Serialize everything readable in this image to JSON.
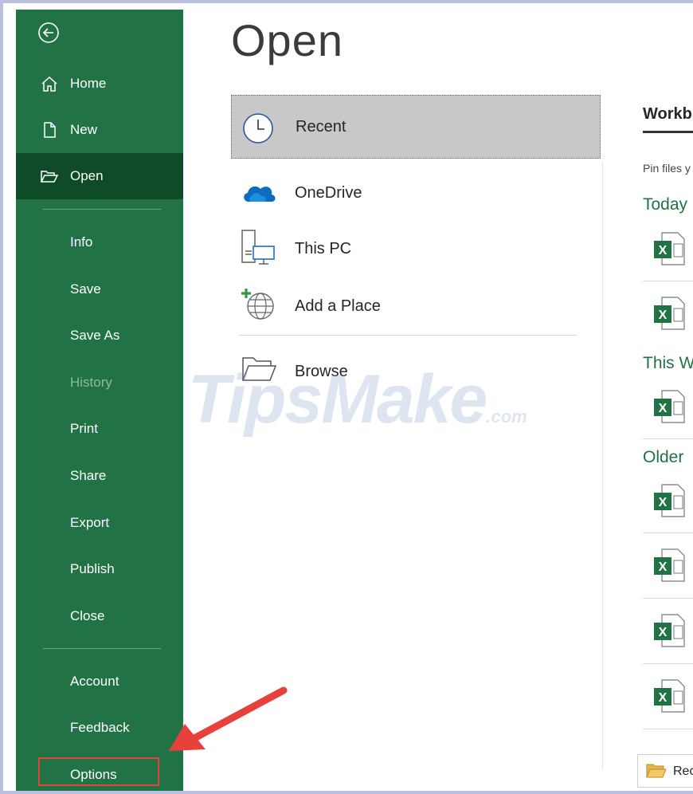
{
  "sidebar": {
    "items": [
      {
        "label": "Home"
      },
      {
        "label": "New"
      },
      {
        "label": "Open"
      },
      {
        "label": "Info"
      },
      {
        "label": "Save"
      },
      {
        "label": "Save As"
      },
      {
        "label": "History"
      },
      {
        "label": "Print"
      },
      {
        "label": "Share"
      },
      {
        "label": "Export"
      },
      {
        "label": "Publish"
      },
      {
        "label": "Close"
      },
      {
        "label": "Account"
      },
      {
        "label": "Feedback"
      },
      {
        "label": "Options"
      }
    ],
    "active": "Open",
    "disabled": "History",
    "highlighted": "Options"
  },
  "main": {
    "title": "Open",
    "locations": [
      {
        "label": "Recent",
        "icon": "clock-icon"
      },
      {
        "label": "OneDrive",
        "icon": "cloud-icon"
      },
      {
        "label": "This PC",
        "icon": "computer-icon"
      },
      {
        "label": "Add a Place",
        "icon": "globe-add-icon"
      },
      {
        "label": "Browse",
        "icon": "folder-icon"
      }
    ]
  },
  "right_pane": {
    "tab": "Workb",
    "pin_hint": "Pin files y",
    "groups": [
      "Today",
      "This We",
      "Older"
    ],
    "recover_label": "Rec"
  },
  "watermark": {
    "text": "TipsMake",
    "suffix": ".com"
  },
  "colors": {
    "sidebar_bg": "#217346",
    "sidebar_active": "#0f4b28",
    "group_heading": "#217346",
    "highlight_box": "#e1453c",
    "selected_location": "#c8c8c8"
  }
}
